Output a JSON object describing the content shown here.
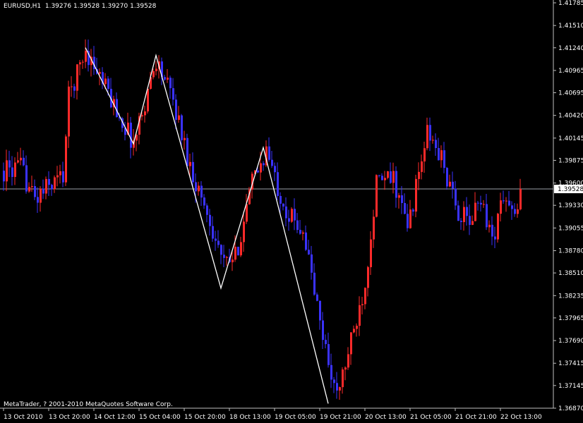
{
  "header": {
    "symbol": "EURUSD,H1",
    "ohlc": "1.39276 1.39528 1.39270 1.39528"
  },
  "footer": {
    "copyright": "MetaTrader, ? 2001-2010 MetaQuotes Software Corp."
  },
  "colors": {
    "background": "#000000",
    "bull": "#ff2a2a",
    "bear": "#3a32ff",
    "zigzag": "#ffffff",
    "axis": "#c0c0c0",
    "text": "#ffffff",
    "price_line": "#9aa0a8"
  },
  "chart_data": {
    "type": "candlestick",
    "symbol": "EURUSD",
    "timeframe": "H1",
    "y_ticks": [
      "1.41785",
      "1.41510",
      "1.41240",
      "1.40965",
      "1.40695",
      "1.40420",
      "1.40145",
      "1.39875",
      "1.39600",
      "1.39330",
      "1.39055",
      "1.38780",
      "1.38510",
      "1.38235",
      "1.37965",
      "1.37690",
      "1.37415",
      "1.37145",
      "1.36870"
    ],
    "ylim": [
      1.3687,
      1.41785
    ],
    "x_ticks": [
      "13 Oct 2010",
      "13 Oct 20:00",
      "14 Oct 12:00",
      "15 Oct 04:00",
      "15 Oct 20:00",
      "18 Oct 13:00",
      "19 Oct 05:00",
      "19 Oct 21:00",
      "20 Oct 13:00",
      "21 Oct 05:00",
      "21 Oct 21:00",
      "22 Oct 13:00"
    ],
    "bar_count": 184,
    "current_price": 1.39528,
    "current_price_label": "1.39528",
    "anchors": [
      {
        "i": 0,
        "p": 1.3975
      },
      {
        "i": 6,
        "p": 1.3978
      },
      {
        "i": 11,
        "p": 1.394
      },
      {
        "i": 17,
        "p": 1.396
      },
      {
        "i": 21,
        "p": 1.397
      },
      {
        "i": 23,
        "p": 1.4065
      },
      {
        "i": 29,
        "p": 1.4122
      },
      {
        "i": 36,
        "p": 1.4075
      },
      {
        "i": 46,
        "p": 1.4008
      },
      {
        "i": 54,
        "p": 1.411
      },
      {
        "i": 60,
        "p": 1.406
      },
      {
        "i": 66,
        "p": 1.398
      },
      {
        "i": 74,
        "p": 1.3905
      },
      {
        "i": 78,
        "p": 1.386
      },
      {
        "i": 82,
        "p": 1.387
      },
      {
        "i": 84,
        "p": 1.39
      },
      {
        "i": 88,
        "p": 1.396
      },
      {
        "i": 93,
        "p": 1.4
      },
      {
        "i": 96,
        "p": 1.3965
      },
      {
        "i": 101,
        "p": 1.392
      },
      {
        "i": 106,
        "p": 1.3905
      },
      {
        "i": 112,
        "p": 1.379
      },
      {
        "i": 118,
        "p": 1.37
      },
      {
        "i": 124,
        "p": 1.378
      },
      {
        "i": 128,
        "p": 1.384
      },
      {
        "i": 132,
        "p": 1.396
      },
      {
        "i": 138,
        "p": 1.3965
      },
      {
        "i": 143,
        "p": 1.3905
      },
      {
        "i": 150,
        "p": 1.402
      },
      {
        "i": 155,
        "p": 1.399
      },
      {
        "i": 160,
        "p": 1.393
      },
      {
        "i": 165,
        "p": 1.391
      },
      {
        "i": 169,
        "p": 1.3945
      },
      {
        "i": 173,
        "p": 1.389
      },
      {
        "i": 177,
        "p": 1.3945
      },
      {
        "i": 181,
        "p": 1.3915
      },
      {
        "i": 183,
        "p": 1.39528
      }
    ],
    "zigzag": [
      {
        "i": 29,
        "p": 1.41242
      },
      {
        "i": 46,
        "p": 1.40075
      },
      {
        "i": 54,
        "p": 1.41148
      },
      {
        "i": 77,
        "p": 1.38325
      },
      {
        "i": 92,
        "p": 1.4003
      },
      {
        "i": 115,
        "p": 1.36926
      }
    ]
  }
}
